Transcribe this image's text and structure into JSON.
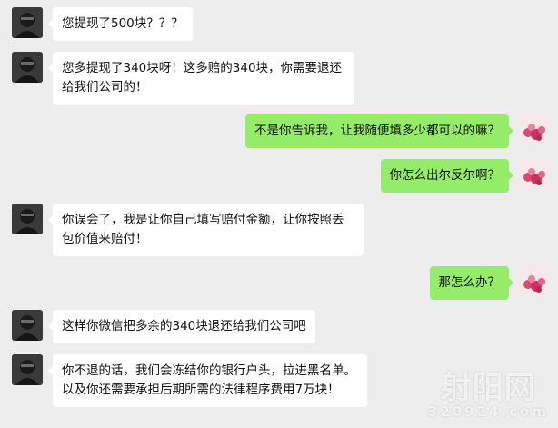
{
  "messages": [
    {
      "side": "left",
      "text": "您提现了500块？？？"
    },
    {
      "side": "left",
      "text": "您多提现了340块呀！这多赔的340块，你需要退还给我们公司的！"
    },
    {
      "side": "right",
      "text": "不是你告诉我，让我随便填多少都可以的嘛？"
    },
    {
      "side": "right",
      "text": "你怎么出尔反尔啊？"
    },
    {
      "side": "left",
      "text": "你误会了，我是让你自己填写赔付金额，让你按照丢包价值来赔付！"
    },
    {
      "side": "right",
      "text": "那怎么办？"
    },
    {
      "side": "left",
      "text": "这样你微信把多余的340块退还给我们公司吧"
    },
    {
      "side": "left",
      "text": "你不退的话，我们会冻结你的银行户头，拉进黑名单。以及你还需要承担后期所需的法律程序费用7万块！"
    }
  ],
  "watermark": {
    "main": "射阳网",
    "sub": "320924.com"
  }
}
